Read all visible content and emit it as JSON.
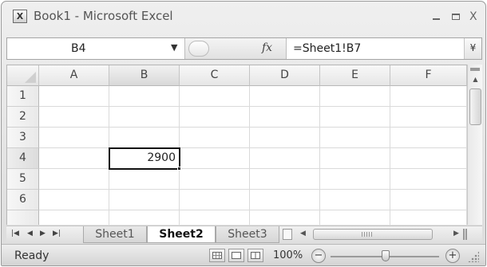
{
  "window": {
    "title": "Book1 - Microsoft Excel",
    "app_icon_glyph": "X",
    "minimize_icon": "minimize-icon",
    "maximize_icon": "maximize-icon",
    "close_glyph": "X"
  },
  "formula_bar": {
    "name_box": "B4",
    "fx_label": "fx",
    "formula": "=Sheet1!B7",
    "expand_glyph": "¥"
  },
  "grid": {
    "columns": [
      "A",
      "B",
      "C",
      "D",
      "E",
      "F"
    ],
    "rows": [
      "1",
      "2",
      "3",
      "4",
      "5",
      "6"
    ],
    "active_cell": "B4",
    "cells": {
      "B4": "2900"
    }
  },
  "sheets": {
    "tabs": [
      "Sheet1",
      "Sheet2",
      "Sheet3"
    ],
    "active": "Sheet2",
    "nav": [
      "|◀",
      "◀",
      "▶",
      "▶|"
    ]
  },
  "status": {
    "text": "Ready",
    "zoom": "100%",
    "zoom_out": "−",
    "zoom_in": "+"
  }
}
